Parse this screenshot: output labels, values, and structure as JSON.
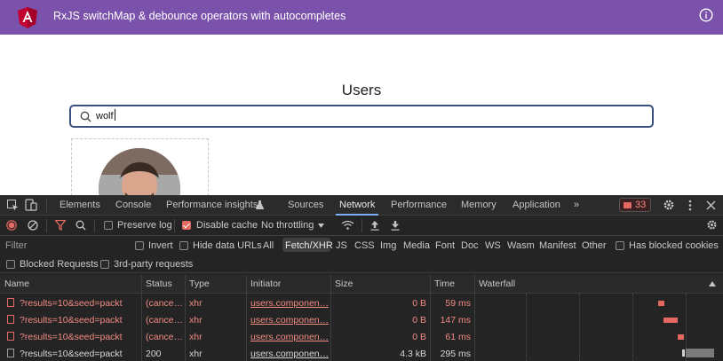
{
  "app": {
    "title": "RxJS switchMap & debounce operators with autocompletes",
    "logo_icon": "angular-logo-icon",
    "info_icon": "info-icon",
    "header_color": "#7b52ab"
  },
  "main": {
    "title": "Users",
    "search": {
      "value": "wolf",
      "icon": "search-icon"
    },
    "user_card": {
      "avatar": "avatar"
    }
  },
  "devtools": {
    "tabs": [
      {
        "label": "Elements"
      },
      {
        "label": "Console"
      },
      {
        "label": "Performance insights"
      },
      {
        "label": "Sources"
      },
      {
        "label": "Network"
      },
      {
        "label": "Performance"
      },
      {
        "label": "Memory"
      },
      {
        "label": "Application"
      },
      {
        "label": "»"
      }
    ],
    "active_tab": "Network",
    "issues_count": "33",
    "toolbar": {
      "preserve_log": "Preserve log",
      "disable_cache": "Disable cache",
      "throttling": "No throttling"
    },
    "filter": {
      "placeholder": "Filter",
      "invert": "Invert",
      "hide_data_urls": "Hide data URLs",
      "types": [
        "All",
        "Fetch/XHR",
        "JS",
        "CSS",
        "Img",
        "Media",
        "Font",
        "Doc",
        "WS",
        "Wasm",
        "Manifest",
        "Other"
      ],
      "active_type": "Fetch/XHR",
      "has_blocked_cookies": "Has blocked cookies",
      "blocked_requests": "Blocked Requests",
      "third_party": "3rd-party requests"
    },
    "columns": {
      "name": "Name",
      "status": "Status",
      "type": "Type",
      "initiator": "Initiator",
      "size": "Size",
      "time": "Time",
      "waterfall": "Waterfall"
    },
    "rows": [
      {
        "name": "?results=10&seed=packt",
        "status": "(cance…",
        "type": "xhr",
        "initiator": "users.componen…",
        "size": "0 B",
        "time": "59 ms",
        "error": true
      },
      {
        "name": "?results=10&seed=packt",
        "status": "(cance…",
        "type": "xhr",
        "initiator": "users.componen…",
        "size": "0 B",
        "time": "147 ms",
        "error": true
      },
      {
        "name": "?results=10&seed=packt",
        "status": "(cance…",
        "type": "xhr",
        "initiator": "users.componen…",
        "size": "0 B",
        "time": "61 ms",
        "error": true
      },
      {
        "name": "?results=10&seed=packt",
        "status": "200",
        "type": "xhr",
        "initiator": "users.componen…",
        "size": "4.3 kB",
        "time": "295 ms",
        "error": false
      }
    ]
  }
}
